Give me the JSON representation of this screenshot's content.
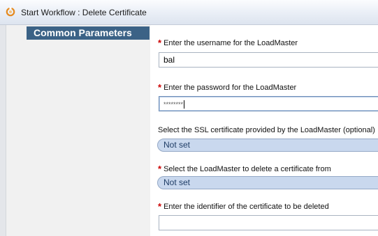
{
  "window": {
    "title": "Start Workflow : Delete Certificate",
    "icon": "workflow-icon"
  },
  "sidebar": {
    "section_label": "Common Parameters"
  },
  "form": {
    "username": {
      "label": "Enter the username for the LoadMaster",
      "required_mark": "*",
      "value": "bal"
    },
    "password": {
      "label": "Enter the password for the LoadMaster",
      "required_mark": "*",
      "value": "********"
    },
    "ssl_certificate": {
      "label": "Select the SSL certificate provided by the LoadMaster (optional)",
      "value": "Not set"
    },
    "loadmaster": {
      "label": "Select the LoadMaster to delete a certificate from",
      "required_mark": "*",
      "value": "Not set"
    },
    "certificate_identifier": {
      "label": "Enter the identifier of the certificate to be deleted",
      "required_mark": "*",
      "value": ""
    }
  },
  "colors": {
    "section_tab_bg": "#3b6286",
    "required_star": "#cc0000",
    "select_bg": "#c9d8ee"
  }
}
